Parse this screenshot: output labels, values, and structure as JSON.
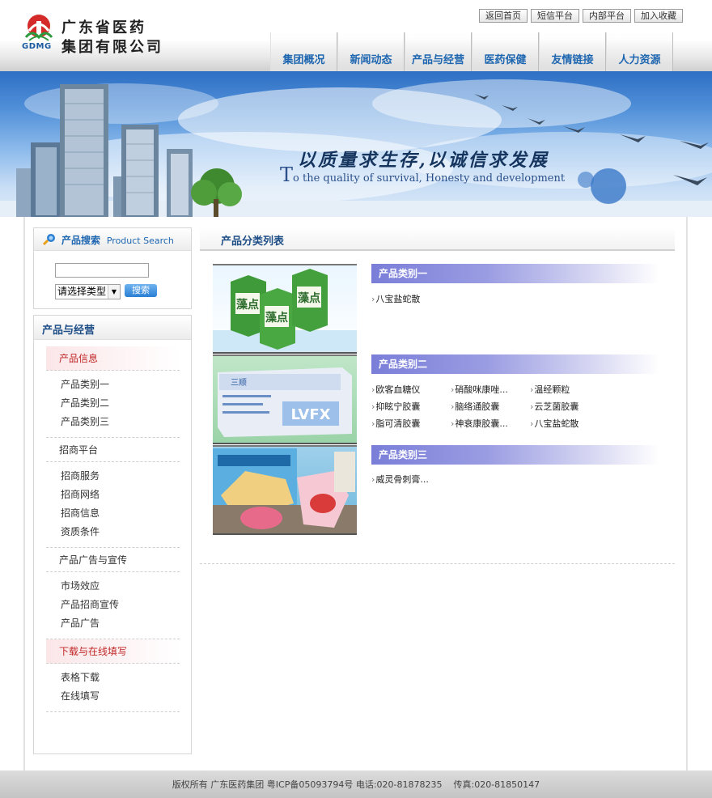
{
  "logo": {
    "name_line1": "广东省医药",
    "name_line2": "集团有限公司",
    "abbr": "GDMG"
  },
  "toplinks": [
    "返回首页",
    "短信平台",
    "内部平台",
    "加入收藏"
  ],
  "nav": [
    "集团概况",
    "新闻动态",
    "产品与经营",
    "医药保健",
    "友情链接",
    "人力资源"
  ],
  "banner": {
    "slogan": "以质量求生存,以诚信求发展",
    "english_initial": "T",
    "english_rest": "o the quality of survival, Honesty and development"
  },
  "search": {
    "title": "产品搜索",
    "title_en": "Product Search",
    "input_value": "",
    "select_value": "请选择类型",
    "button_label": "搜索"
  },
  "menu": {
    "title": "产品与经营",
    "groups": [
      {
        "label": "产品信息",
        "highlight": true,
        "items": [
          "产品类别一",
          "产品类别二",
          "产品类别三"
        ]
      },
      {
        "label": "招商平台",
        "highlight": false,
        "items": [
          "招商服务",
          "招商网络",
          "招商信息",
          "资质条件"
        ]
      },
      {
        "label": "产品广告与宣传",
        "highlight": false,
        "items": [
          "市场效应",
          "产品招商宣传",
          "产品广告"
        ]
      },
      {
        "label": "下载与在线填写",
        "highlight": true,
        "items": [
          "表格下载",
          "在线填写"
        ]
      }
    ]
  },
  "content": {
    "title": "产品分类列表",
    "categories": [
      {
        "title": "产品类别一",
        "products": [
          "八宝盐蛇散"
        ]
      },
      {
        "title": "产品类别二",
        "products": [
          "欧客血糖仪",
          "硝酸咪康唑...",
          "温经颗粒",
          "抑眩宁胶囊",
          "脑络通胶囊",
          "云芝菌胶囊",
          "脂可清胶囊",
          "神衰康胶囊...",
          "八宝盐蛇散"
        ]
      },
      {
        "title": "产品类别三",
        "products": [
          "威灵骨刺膏..."
        ]
      }
    ],
    "image_texts": {
      "cat1_box": "藻点",
      "cat2_box": "LVFX",
      "cat2_brand": "三顺"
    }
  },
  "footer": {
    "copyright": "版权所有 广东医药集团 粤ICP备05093794号 电话:020-81878235",
    "fax": "传真:020-81850147"
  },
  "colors": {
    "nav_text": "#1e66b0",
    "category_bar": "#7a7ed8",
    "highlight_text": "#c02626"
  }
}
